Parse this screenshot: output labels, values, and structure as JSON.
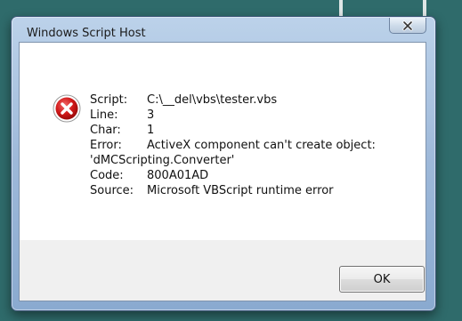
{
  "window": {
    "title": "Windows Script Host",
    "close_icon": "close-x-icon"
  },
  "message": {
    "icon": "error-icon",
    "script_label": "Script:",
    "script_value": "C:\\__del\\vbs\\tester.vbs",
    "line_label": "Line:",
    "line_value": "3",
    "char_label": "Char:",
    "char_value": "1",
    "error_label": "Error:",
    "error_value": "ActiveX component can't create object:",
    "error_continuation": "'dMCScripting.Converter'",
    "code_label": "Code:",
    "code_value": "800A01AD",
    "source_label": "Source:",
    "source_value": "Microsoft VBScript runtime error"
  },
  "buttons": {
    "ok_label": "OK"
  },
  "colors": {
    "desktop": "#2f6b6b",
    "error_red": "#cc1414"
  }
}
